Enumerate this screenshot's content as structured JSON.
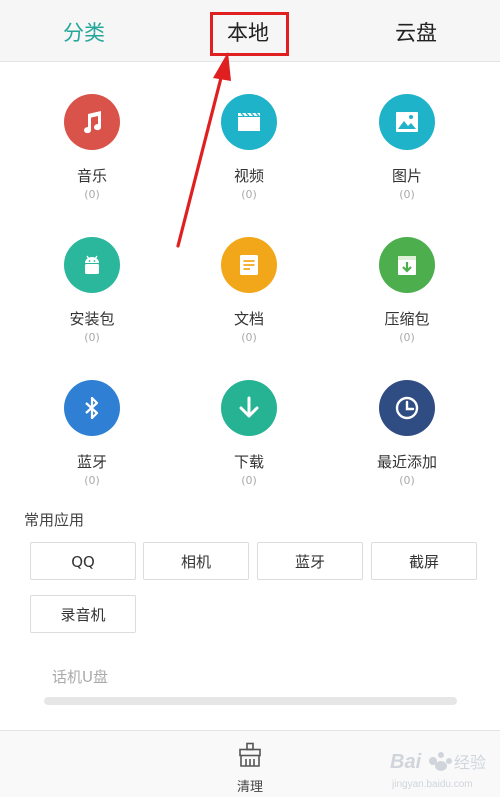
{
  "tabs": [
    {
      "label": "分类",
      "active": true
    },
    {
      "label": "本地",
      "active": false,
      "highlighted": true
    },
    {
      "label": "云盘",
      "active": false
    }
  ],
  "categories": [
    {
      "label": "音乐",
      "count": "(0)",
      "color": "#d9534a",
      "icon": "music-icon"
    },
    {
      "label": "视频",
      "count": "(0)",
      "color": "#1fb3c9",
      "icon": "video-icon"
    },
    {
      "label": "图片",
      "count": "(0)",
      "color": "#1fb3c9",
      "icon": "image-icon"
    },
    {
      "label": "安装包",
      "count": "(0)",
      "color": "#2bb79c",
      "icon": "android-icon"
    },
    {
      "label": "文档",
      "count": "(0)",
      "color": "#f2a71b",
      "icon": "document-icon"
    },
    {
      "label": "压缩包",
      "count": "(0)",
      "color": "#4cae4c",
      "icon": "archive-icon"
    },
    {
      "label": "蓝牙",
      "count": "(0)",
      "color": "#2f80d4",
      "icon": "bluetooth-icon"
    },
    {
      "label": "下载",
      "count": "(0)",
      "color": "#26b394",
      "icon": "download-icon"
    },
    {
      "label": "最近添加",
      "count": "(0)",
      "color": "#2f4d82",
      "icon": "clock-icon"
    }
  ],
  "common_apps": {
    "title": "常用应用",
    "items": [
      "QQ",
      "相机",
      "蓝牙",
      "截屏",
      "录音机"
    ]
  },
  "usb_storage": {
    "label": "话机U盘"
  },
  "bottom": {
    "clean_label": "清理"
  },
  "annotation": {
    "arrow_color": "#e02020"
  },
  "watermark": {
    "text": "Baidu经验",
    "sub": "jingyan.baidu.com"
  }
}
